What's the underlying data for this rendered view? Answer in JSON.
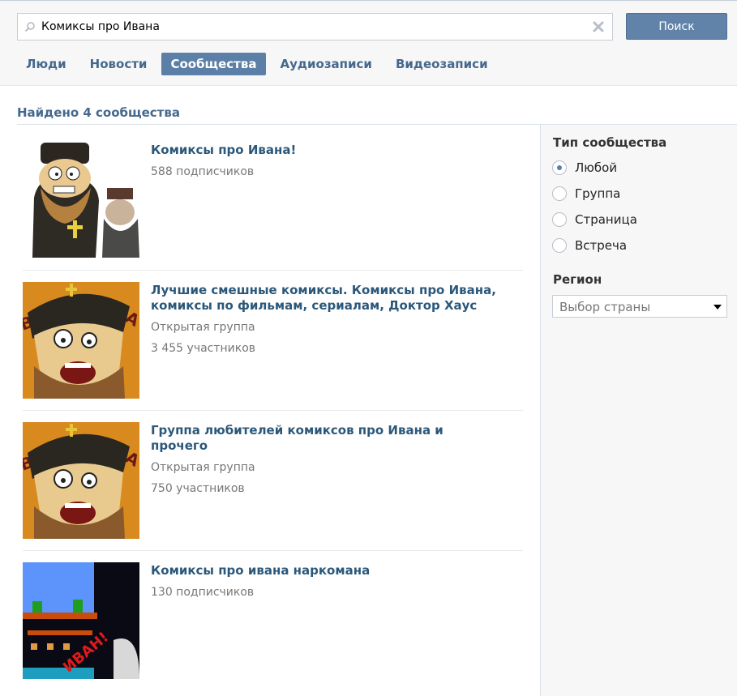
{
  "search": {
    "query": "Комиксы про Ивана",
    "button_label": "Поиск"
  },
  "tabs": [
    {
      "label": "Люди",
      "active": false
    },
    {
      "label": "Новости",
      "active": false
    },
    {
      "label": "Сообщества",
      "active": true
    },
    {
      "label": "Аудиозаписи",
      "active": false
    },
    {
      "label": "Видеозаписи",
      "active": false
    }
  ],
  "results_summary": "Найдено 4 сообщества",
  "results": [
    {
      "title": "Комиксы про Ивана!",
      "meta": [
        "588 подписчиков"
      ],
      "thumb": "priest-comic-thumb"
    },
    {
      "title": "Лучшие смешные комиксы. Комиксы про Ивана, комиксы по фильмам, сериалам, Доктор Хаус",
      "meta": [
        "Открытая группа",
        "3 455 участников"
      ],
      "thumb": "priest-face-thumb"
    },
    {
      "title": "Группа любителей комиксов про Ивана и прочего",
      "meta": [
        "Открытая группа",
        "750 участников"
      ],
      "thumb": "priest-face-thumb"
    },
    {
      "title": "Комиксы про ивана наркомана",
      "meta": [
        "130 подписчиков"
      ],
      "thumb": "pixel-game-thumb"
    }
  ],
  "sidebar": {
    "type_heading": "Тип сообщества",
    "types": [
      {
        "label": "Любой",
        "selected": true
      },
      {
        "label": "Группа",
        "selected": false
      },
      {
        "label": "Страница",
        "selected": false
      },
      {
        "label": "Встреча",
        "selected": false
      }
    ],
    "region_heading": "Регион",
    "region_value": "Выбор страны"
  },
  "colors": {
    "accent": "#5b7fa6",
    "link": "#2b587a",
    "tab_text": "#45688e",
    "button": "#6183aa"
  },
  "icons": {
    "search": "search-icon",
    "clear": "clear-icon",
    "dropdown": "chevron-down-icon"
  }
}
